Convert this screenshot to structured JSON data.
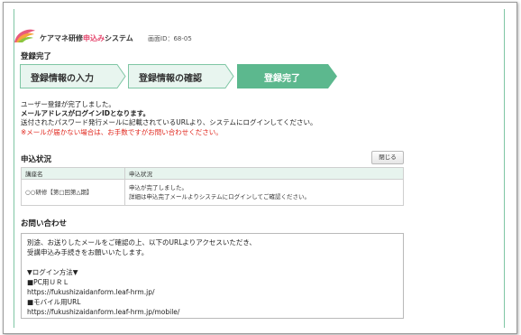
{
  "header": {
    "system_name_prefix": "ケアマネ研修",
    "system_name_accent": "申込み",
    "system_name_suffix": "システム",
    "screen_id": "画面ID：68-05"
  },
  "page_title": "登録完了",
  "steps": [
    {
      "label": "登録情報の入力",
      "state": "done"
    },
    {
      "label": "登録情報の確認",
      "state": "done"
    },
    {
      "label": "登録完了",
      "state": "current"
    }
  ],
  "messages": {
    "line1": "ユーザー登録が完了しました。",
    "line2": "メールアドレスがログインIDとなります。",
    "line3": "送付されたパスワード発行メールに記載されているURLより、システムにログインしてください。",
    "warning": "※メールが届かない場合は、お手数ですがお問い合わせください。"
  },
  "application": {
    "title": "申込状況",
    "close_label": "閉じる",
    "columns": [
      "講座名",
      "申込状況"
    ],
    "row": {
      "course": "○○研修【第□回第△期】",
      "status_line1": "申込が完了しました。",
      "status_line2": "詳細は申込完了メールよりシステムにログインしてご確認ください。"
    }
  },
  "inquiry": {
    "title": "お問い合わせ",
    "lines": [
      "別途、お送りしたメールをご確認の上、以下のURLよりアクセスいただき、",
      "受講申込み手続きをお願いいたします。",
      "",
      "▼ログイン方法▼",
      "■PC用ＵＲＬ",
      "https://fukushizaidanform.leaf-hrm.jp/",
      "■モバイル用URL",
      "https://fukushizaidanform.leaf-hrm.jp/mobile/"
    ]
  },
  "colors": {
    "accent": "#e5466d",
    "step_current": "#5cb88e",
    "step_done_bg": "#e8f5ef",
    "warning": "#e0261c",
    "table_header": "#e7f4ee"
  }
}
